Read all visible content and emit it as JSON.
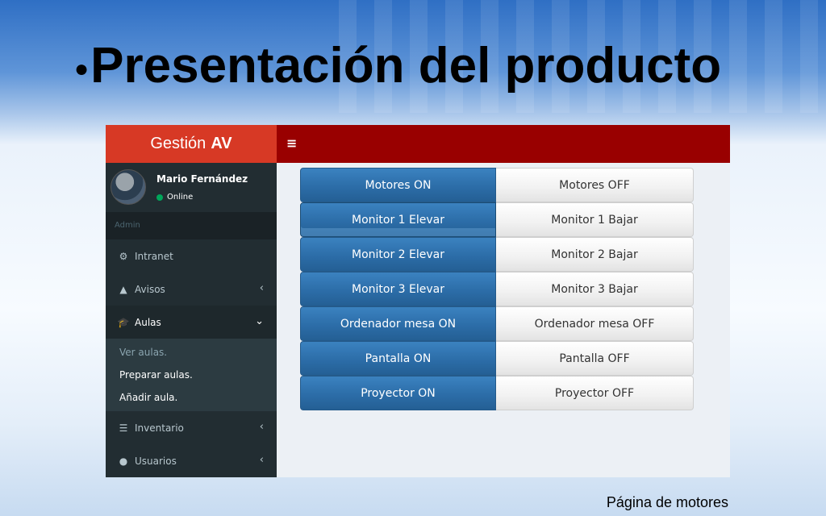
{
  "slide": {
    "title": "Presentación del producto",
    "bullet": "●",
    "caption": "Página de motores"
  },
  "app": {
    "brand_light": "Gestión",
    "brand_bold": "AV",
    "toggle_icon": "≡",
    "user": {
      "name": "Mario Fernández",
      "status": "Online"
    },
    "sidebar_header": "Admin",
    "menu": [
      {
        "label": "Intranet",
        "icon": "⚙",
        "chevron": ""
      },
      {
        "label": "Avisos",
        "icon": "▲",
        "chevron": "‹"
      },
      {
        "label": "Aulas",
        "icon": "🎓",
        "chevron": "⌄"
      }
    ],
    "submenu": [
      "Ver aulas.",
      "Preparar aulas.",
      "Añadir aula."
    ],
    "menu_after": [
      {
        "label": "Inventario",
        "icon": "☰",
        "chevron": "‹"
      },
      {
        "label": "Usuarios",
        "icon": "●",
        "chevron": "‹"
      }
    ],
    "controls": [
      {
        "on": "Motores ON",
        "off": "Motores OFF"
      },
      {
        "on": "Monitor 1 Elevar",
        "off": "Monitor 1 Bajar"
      },
      {
        "on": "Monitor 2 Elevar",
        "off": "Monitor 2 Bajar"
      },
      {
        "on": "Monitor 3 Elevar",
        "off": "Monitor 3 Bajar"
      },
      {
        "on": "Ordenador mesa ON",
        "off": "Ordenador mesa OFF"
      },
      {
        "on": "Pantalla ON",
        "off": "Pantalla OFF"
      },
      {
        "on": "Proyector ON",
        "off": "Proyector OFF"
      }
    ]
  },
  "colors": {
    "brand": "#d73925",
    "topbar": "#990000",
    "sidebar": "#222d32",
    "primary": "#2c6da8"
  }
}
